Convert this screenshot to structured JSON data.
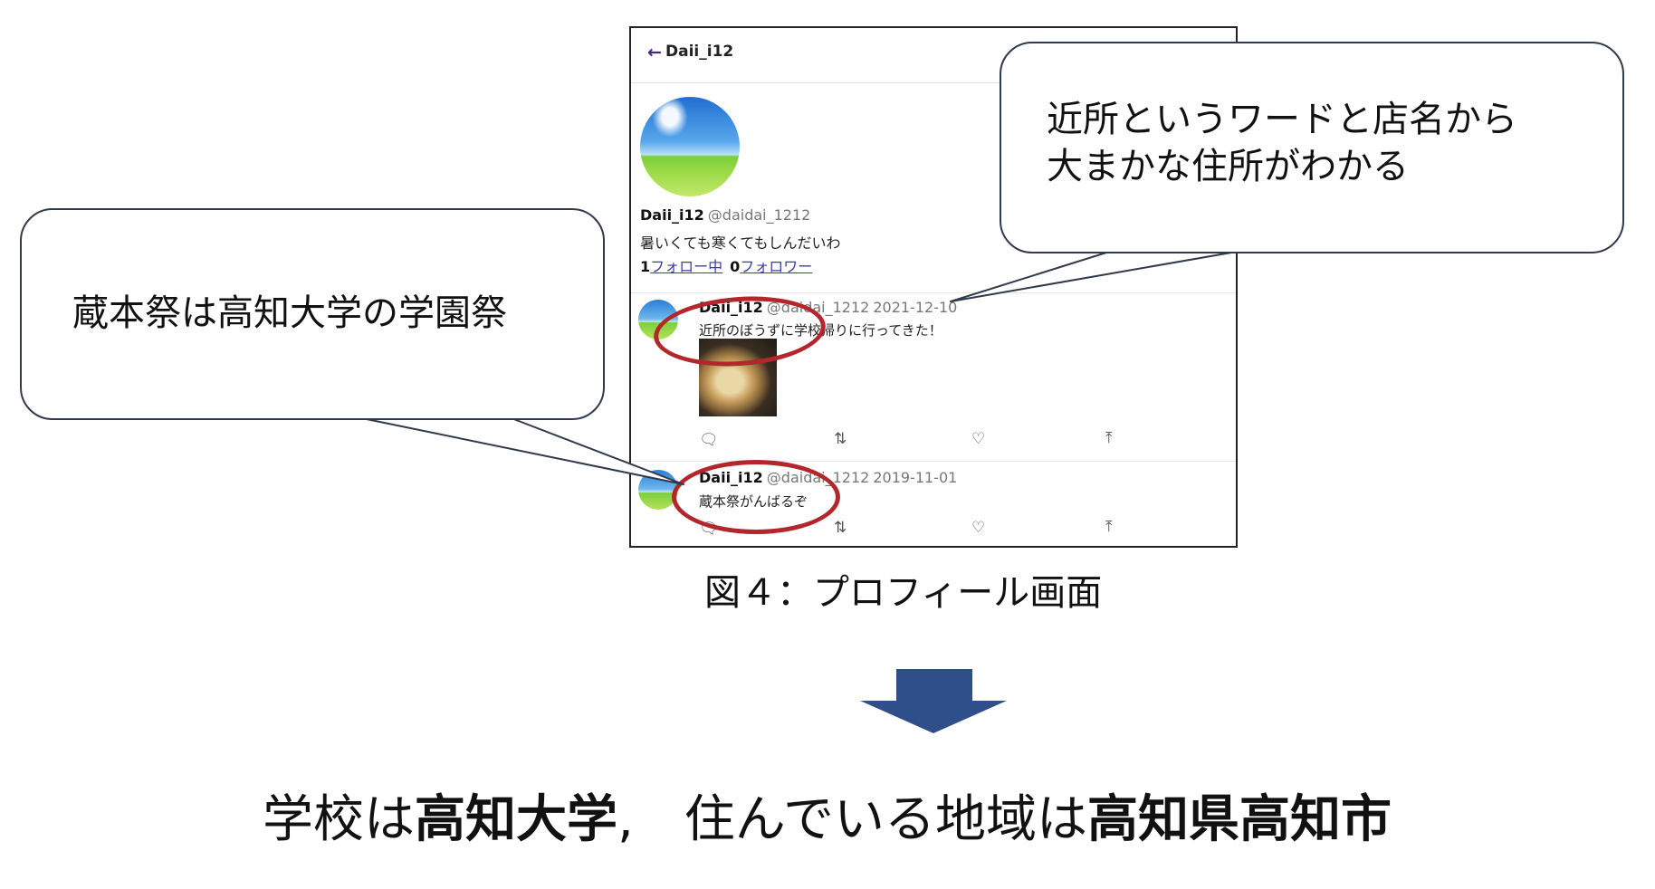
{
  "profile": {
    "back_icon": "arrow-left-icon",
    "header_title": "Daii_i12",
    "name": "Daii_i12",
    "handle": "@daidai_1212",
    "bio": "暑いくても寒くてもしんだいわ",
    "following_count": "1",
    "following_label": "フォロー中",
    "followers_count": "0",
    "followers_label": "フォロワー"
  },
  "tweets": [
    {
      "name": "Daii_i12",
      "handle": "@daidai_1212",
      "date": "2021-12-10",
      "text": "近所のぼうずに学校帰りに行ってきた！",
      "has_image": true
    },
    {
      "name": "Daii_i12",
      "handle": "@daidai_1212",
      "date": "2019-11-01",
      "text": "蔵本祭がんばるぞ"
    }
  ],
  "actions": {
    "reply_icon": "reply-icon",
    "retweet_icon": "retweet-icon",
    "like_icon": "heart-icon",
    "share_icon": "share-icon"
  },
  "callouts": {
    "right_line1": "近所というワードと店名から",
    "right_line2": "大まかな住所がわかる",
    "left": "蔵本祭は高知大学の学園祭"
  },
  "caption": "図４：プロフィール画面",
  "conclusion": {
    "part1": "学校は",
    "part2": "高知大学",
    "part3": ",　住んでいる地域は",
    "part4": "高知県高知市"
  },
  "colors": {
    "highlight_ellipse": "#b3262b",
    "arrow": "#2f4f8a",
    "link": "#3b3bb0"
  }
}
